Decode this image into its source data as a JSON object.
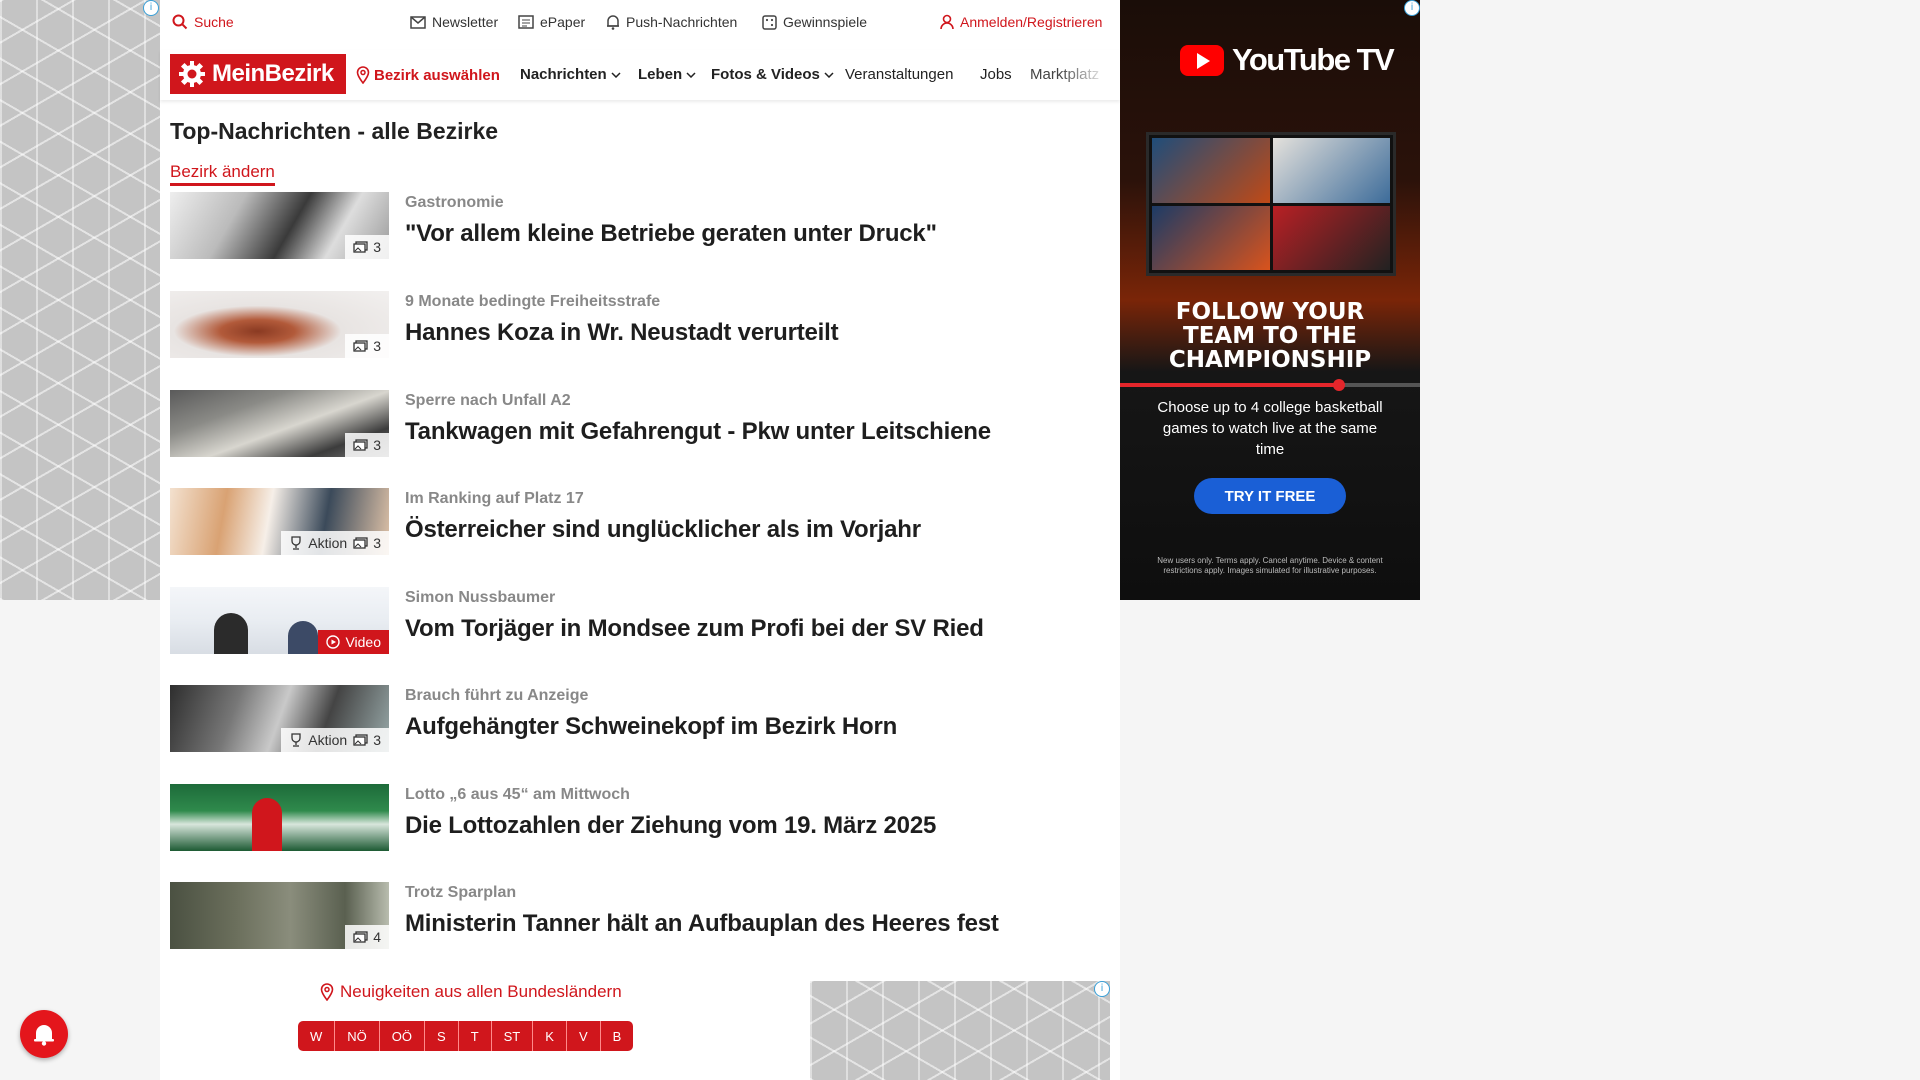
{
  "util_bar": {
    "search": "Suche",
    "newsletter": "Newsletter",
    "epaper": "ePaper",
    "push": "Push-Nachrichten",
    "raffles": "Gewinnspiele",
    "login": "Anmelden/Registrieren"
  },
  "nav": {
    "logo": "MeinBezirk",
    "select_district": "Bezirk auswählen",
    "items": [
      "Nachrichten",
      "Leben",
      "Fotos & Videos",
      "Veranstaltungen",
      "Jobs",
      "Marktplatz"
    ]
  },
  "main": {
    "title": "Top-Nachrichten - alle Bezirke",
    "change_district": "Bezirk ändern",
    "articles": [
      {
        "kicker": "Gastronomie",
        "headline": "\"Vor allem kleine Betriebe geraten unter Druck\"",
        "photos": "3",
        "aktion": "",
        "video": ""
      },
      {
        "kicker": "9 Monate bedingte Freiheitsstrafe",
        "headline": "Hannes Koza in Wr. Neustadt verurteilt",
        "photos": "3",
        "aktion": "",
        "video": ""
      },
      {
        "kicker": "Sperre nach Unfall A2",
        "headline": "Tankwagen mit Gefahrengut - Pkw unter Leitschiene",
        "photos": "3",
        "aktion": "",
        "video": ""
      },
      {
        "kicker": "Im Ranking auf Platz 17",
        "headline": "Österreicher sind unglücklicher als im Vorjahr",
        "photos": "3",
        "aktion": "Aktion",
        "video": ""
      },
      {
        "kicker": "Simon Nussbaumer",
        "headline": "Vom Torjäger in Mondsee zum Profi bei der SV Ried",
        "photos": "",
        "aktion": "",
        "video": "Video"
      },
      {
        "kicker": "Brauch führt zu Anzeige",
        "headline": "Aufgehängter Schweinekopf im Bezirk Horn",
        "photos": "3",
        "aktion": "Aktion",
        "video": ""
      },
      {
        "kicker": "Lotto „6 aus 45“ am Mittwoch",
        "headline": "Die Lottozahlen der Ziehung vom 19. März 2025",
        "photos": "",
        "aktion": "",
        "video": ""
      },
      {
        "kicker": "Trotz Sparplan",
        "headline": "Ministerin Tanner hält an Aufbauplan des Heeres fest",
        "photos": "4",
        "aktion": "",
        "video": ""
      }
    ]
  },
  "states": {
    "label": "Neuigkeiten aus allen Bundesländern",
    "buttons": [
      "W",
      "NÖ",
      "OÖ",
      "S",
      "T",
      "ST",
      "K",
      "V",
      "B"
    ]
  },
  "right_ad": {
    "brand": "YouTube TV",
    "headline_lines": [
      "FOLLOW YOUR",
      "TEAM TO THE",
      "CHAMPIONSHIP"
    ],
    "body": "Choose up to 4 college basketball games to watch live at the same time",
    "cta": "TRY IT FREE",
    "fine_print": "New users only. Terms apply. Cancel anytime. Device & content restrictions apply. Images simulated for illustrative purposes.",
    "progress": 0.73
  },
  "ad_info_symbol": "i",
  "colors": {
    "brand_red": "#d0161c",
    "cta_blue": "#1a5fd6",
    "youtube_red": "#ff0000"
  }
}
